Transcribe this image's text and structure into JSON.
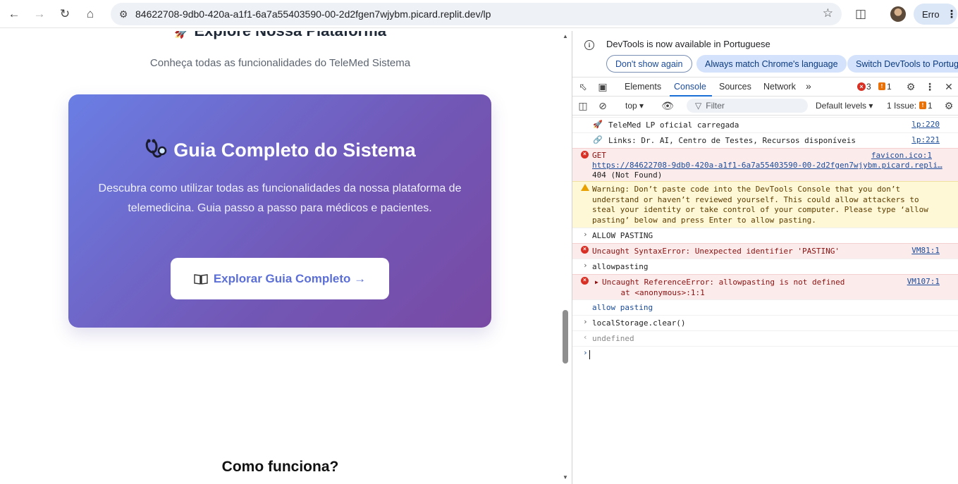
{
  "browser": {
    "url": "84622708-9db0-420a-a1f1-6a7a55403590-00-2d2fgen7wjybm.picard.replit.dev/lp",
    "error_label": "Erro"
  },
  "page": {
    "explore_title": "Explore Nossa Plataforma",
    "explore_subtitle": "Conheça todas as funcionalidades do TeleMed Sistema",
    "card": {
      "title": "Guia Completo do Sistema",
      "description": "Descubra como utilizar todas as funcionalidades da nossa plataforma de telemedicina. Guia passo a passo para médicos e pacientes.",
      "button_label": "Explorar Guia Completo →"
    },
    "como_funciona": "Como funciona?"
  },
  "devtools": {
    "info": {
      "message": "DevTools is now available in Portuguese",
      "dont_show": "Don't show again",
      "match_language": "Always match Chrome's language",
      "switch": "Switch DevTools to Portugu"
    },
    "tabs": [
      "Elements",
      "Console",
      "Sources",
      "Network"
    ],
    "active_tab": "Console",
    "error_count": "3",
    "warning_count": "1",
    "toolbar": {
      "context": "top",
      "filter_placeholder": "Filter",
      "levels": "Default levels",
      "issues_label": "1 Issue:",
      "issues_count": "1"
    },
    "console": {
      "log1": "TeleMed LP oficial carregada",
      "log1_src": "lp:220",
      "log2": "Links: Dr. AI, Centro de Testes, Recursos disponíveis",
      "log2_src": "lp:221",
      "get_label": "GET",
      "get_url": "https://84622708-9db0-420a-a1f1-6a7a55403590-00-2d2fgen7wjybm.picard.repli…",
      "get_status": "404 (Not Found)",
      "get_src": "favicon.ico:1",
      "warning_text": "Warning: Don’t paste code into the DevTools Console that you don’t\nunderstand or haven’t reviewed yourself. This could allow attackers to\nsteal your identity or take control of your computer. Please type ‘allow\npasting’ below and press Enter to allow pasting.",
      "input1": "ALLOW PASTING",
      "err1": "Uncaught SyntaxError: Unexpected identifier 'PASTING'",
      "err1_src": "VM81:1",
      "input2": "allowpasting",
      "err2": "Uncaught ReferenceError: allowpasting is not defined\n    at <anonymous>:1:1",
      "err2_src": "VM107:1",
      "input3": "allow pasting",
      "input4": "localStorage.clear()",
      "result4": "undefined"
    }
  }
}
